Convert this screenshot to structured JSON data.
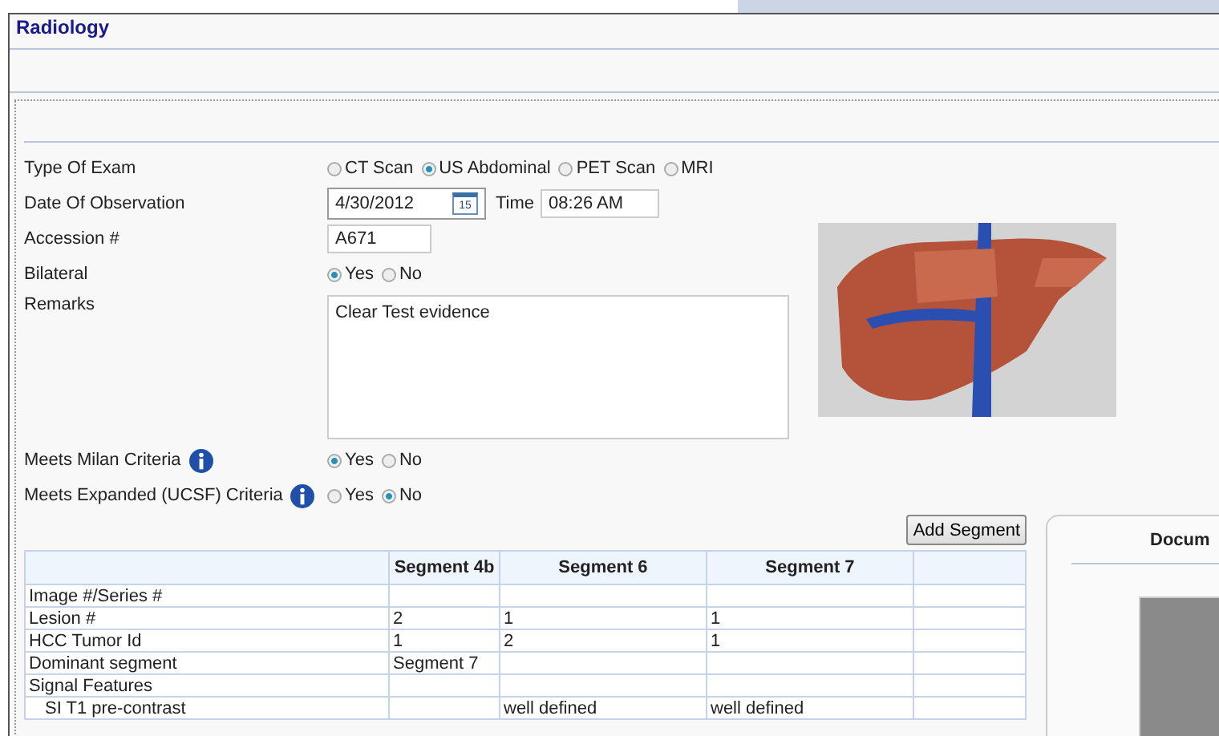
{
  "window": {
    "title": "Radiology"
  },
  "form": {
    "exam_type": {
      "label": "Type Of Exam",
      "options": [
        {
          "label": "CT Scan",
          "selected": false
        },
        {
          "label": "US Abdominal",
          "selected": true
        },
        {
          "label": "PET Scan",
          "selected": false
        },
        {
          "label": "MRI",
          "selected": false
        }
      ]
    },
    "date": {
      "label": "Date Of Observation",
      "value": "4/30/2012",
      "calendar_day": "15",
      "time_label": "Time",
      "time_value": "08:26 AM"
    },
    "accession": {
      "label": "Accession #",
      "value": "A671"
    },
    "bilateral": {
      "label": "Bilateral",
      "options": [
        {
          "label": "Yes",
          "selected": true
        },
        {
          "label": "No",
          "selected": false
        }
      ]
    },
    "remarks": {
      "label": "Remarks",
      "value": "Clear Test evidence"
    },
    "milan": {
      "label": "Meets Milan Criteria",
      "options": [
        {
          "label": "Yes",
          "selected": true
        },
        {
          "label": "No",
          "selected": false
        }
      ]
    },
    "ucsf": {
      "label": "Meets Expanded (UCSF) Criteria",
      "options": [
        {
          "label": "Yes",
          "selected": false
        },
        {
          "label": "No",
          "selected": true
        }
      ]
    }
  },
  "add_segment_button": "Add Segment",
  "table": {
    "columns": [
      "",
      "Segment 4b",
      "Segment 6",
      "Segment 7",
      ""
    ],
    "rows": [
      {
        "kind": "row",
        "cells": [
          "Image #/Series #",
          "",
          "",
          "",
          ""
        ]
      },
      {
        "kind": "row",
        "cells": [
          "Lesion #",
          "2",
          "1",
          "1",
          ""
        ]
      },
      {
        "kind": "row",
        "cells": [
          "HCC Tumor Id",
          "1",
          "2",
          "1",
          ""
        ]
      },
      {
        "kind": "row",
        "cells": [
          "Dominant segment",
          "Segment 7",
          "",
          "",
          ""
        ]
      },
      {
        "kind": "row",
        "cells": [
          "Signal Features",
          "",
          "",
          "",
          ""
        ]
      },
      {
        "kind": "sub",
        "cells": [
          "SI T1 pre-contrast",
          "",
          "well defined",
          "well defined",
          ""
        ]
      }
    ]
  },
  "document_panel": {
    "title": "Docum"
  }
}
